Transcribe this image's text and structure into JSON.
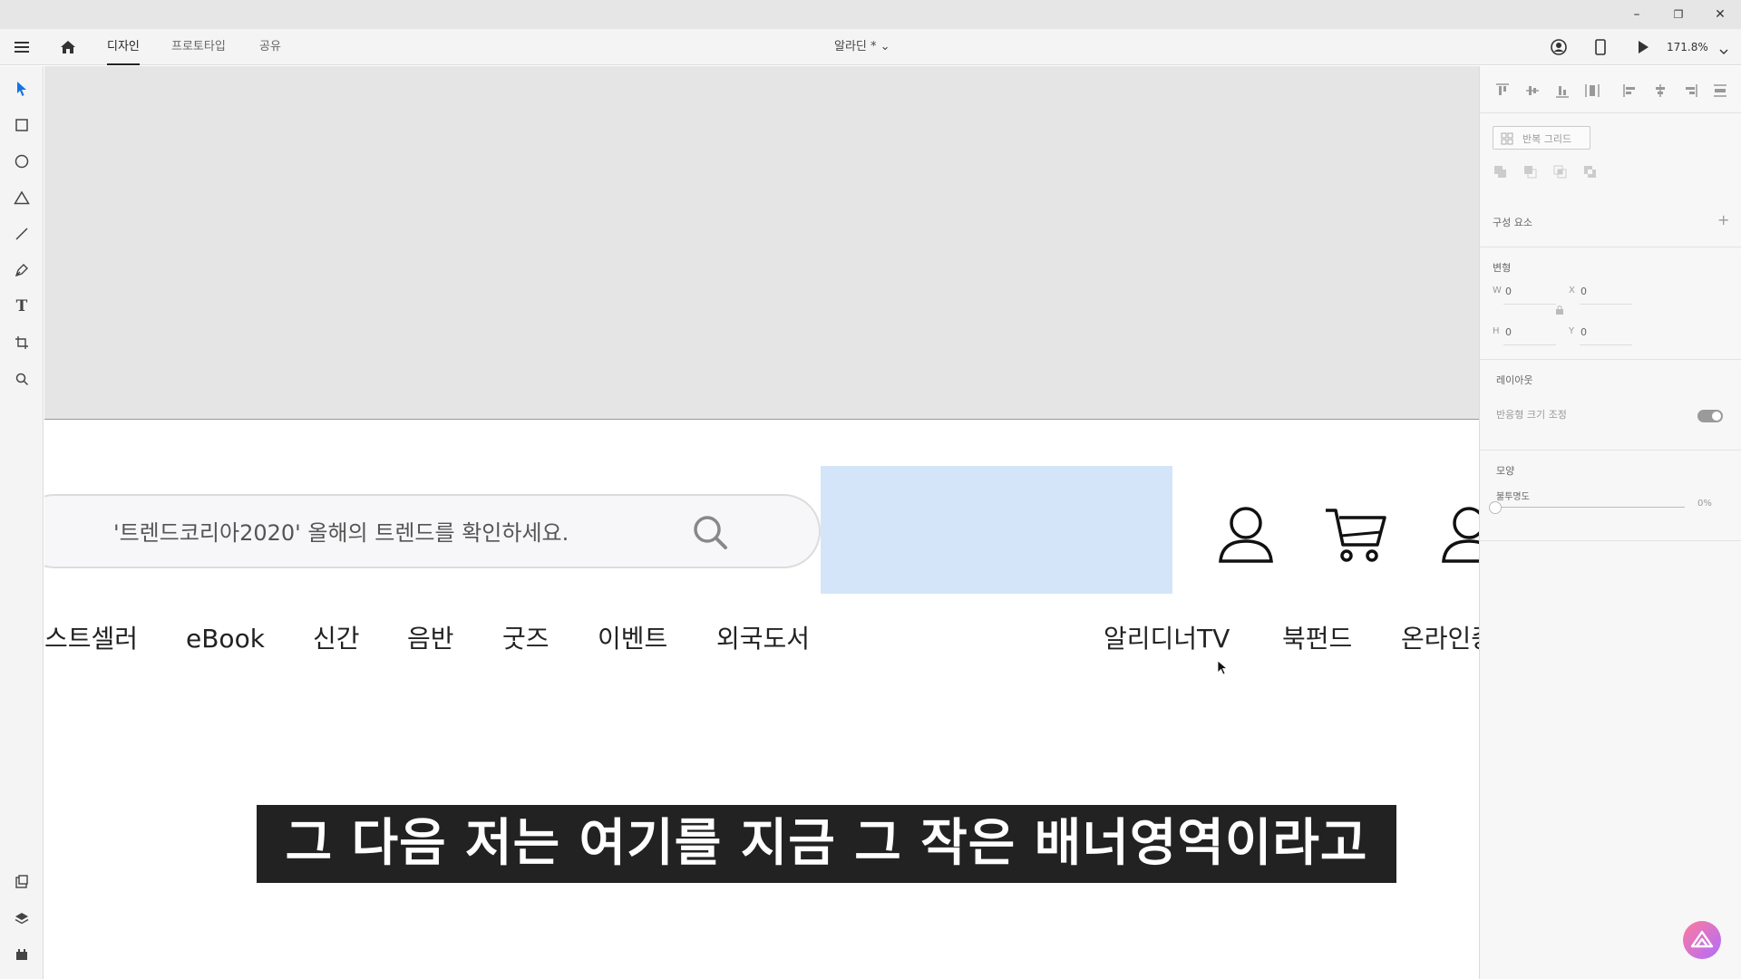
{
  "window": {
    "minimize": "–",
    "maximize": "❐",
    "close": "✕"
  },
  "menubar": {
    "tabs": [
      "디자인",
      "프로토타입",
      "공유"
    ],
    "active_tab": "디자인",
    "doc_title": "알라딘 * ⌄",
    "zoom": "171.8%"
  },
  "canvas": {
    "search_placeholder": "'트렌드코리아2020' 올해의 트렌드를 확인하세요.",
    "nav_items": [
      "스트셀러",
      "eBook",
      "신간",
      "음반",
      "굿즈",
      "이벤트",
      "외국도서",
      "알리디너TV",
      "북펀드",
      "온라인중"
    ],
    "caption": "그 다음 저는 여기를 지금 그 작은 배너영역이라고",
    "banner_color": "#d5e5f9"
  },
  "panel": {
    "repeat_grid": "반복 그리드",
    "components": "구성 요소",
    "transform": "변형",
    "w_label": "W",
    "w_value": "0",
    "x_label": "X",
    "x_value": "0",
    "h_label": "H",
    "h_value": "0",
    "y_label": "Y",
    "y_value": "0",
    "layout": "레이아웃",
    "responsive_resize": "반응형 크기 조정",
    "appearance": "모양",
    "opacity": "불투명도",
    "opacity_value": "0%"
  },
  "colors": {
    "accent": "#1473e6",
    "titlebar": "#e6e6e6",
    "canvas_top": "#e5e5e5"
  }
}
